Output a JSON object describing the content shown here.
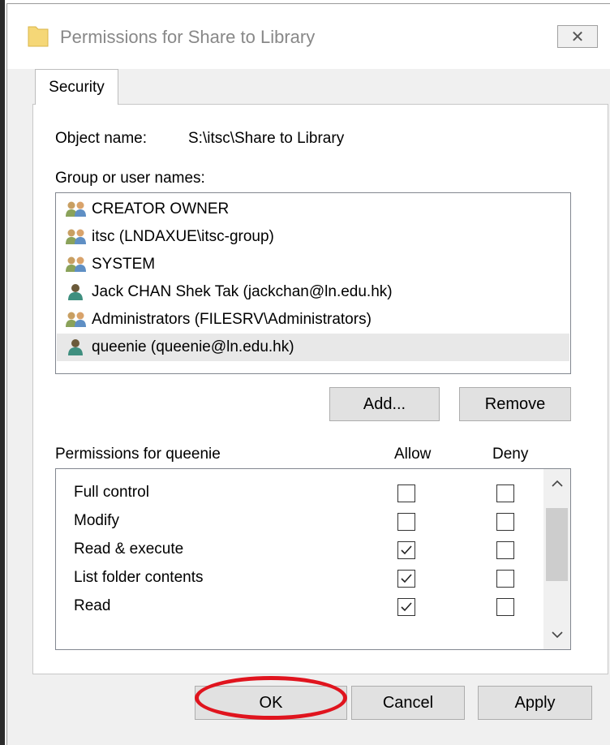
{
  "window": {
    "title": "Permissions for Share to Library",
    "close_glyph": "✕"
  },
  "tabs": [
    {
      "label": "Security"
    }
  ],
  "object": {
    "label": "Object name:",
    "value": "S:\\itsc\\Share to Library"
  },
  "groups": {
    "label": "Group or user names:",
    "items": [
      {
        "name": "CREATOR OWNER",
        "icon": "user-group-icon"
      },
      {
        "name": "itsc (LNDAXUE\\itsc-group)",
        "icon": "user-group-icon"
      },
      {
        "name": "SYSTEM",
        "icon": "user-group-icon"
      },
      {
        "name": "Jack CHAN Shek Tak (jackchan@ln.edu.hk)",
        "icon": "user-icon"
      },
      {
        "name": "Administrators (FILESRV\\Administrators)",
        "icon": "user-group-icon"
      },
      {
        "name": "queenie (queenie@ln.edu.hk)",
        "icon": "user-icon",
        "selected": true
      }
    ],
    "add_label": "Add...",
    "remove_label": "Remove"
  },
  "permissions": {
    "header": "Permissions for queenie",
    "allow_header": "Allow",
    "deny_header": "Deny",
    "items": [
      {
        "name": "Full control",
        "allow": false,
        "deny": false
      },
      {
        "name": "Modify",
        "allow": false,
        "deny": false
      },
      {
        "name": "Read & execute",
        "allow": true,
        "deny": false
      },
      {
        "name": "List folder contents",
        "allow": true,
        "deny": false
      },
      {
        "name": "Read",
        "allow": true,
        "deny": false
      }
    ]
  },
  "buttons": {
    "ok": "OK",
    "cancel": "Cancel",
    "apply": "Apply"
  },
  "colors": {
    "highlight_ellipse": "#e0141e",
    "selected_row": "#e8e8e8",
    "button_face": "#e1e1e1"
  }
}
